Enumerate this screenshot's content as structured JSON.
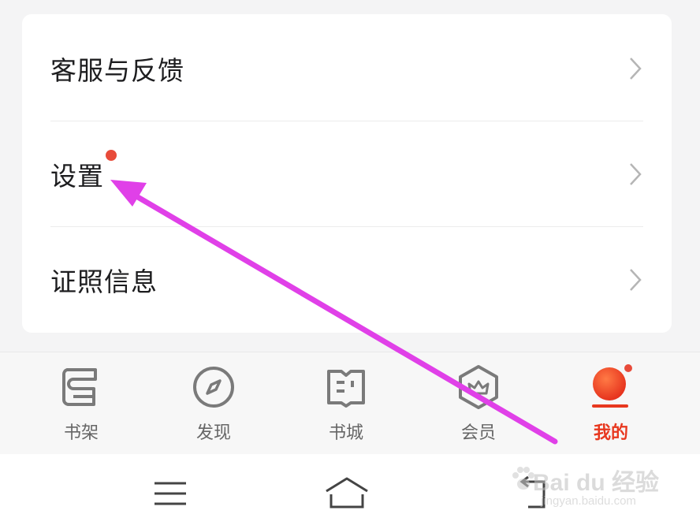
{
  "menu": {
    "items": [
      {
        "label": "客服与反馈"
      },
      {
        "label": "设置"
      },
      {
        "label": "证照信息"
      }
    ]
  },
  "tabs": [
    {
      "label": "书架",
      "icon": "bookshelf-icon"
    },
    {
      "label": "发现",
      "icon": "compass-icon"
    },
    {
      "label": "书城",
      "icon": "book-store-icon"
    },
    {
      "label": "会员",
      "icon": "vip-crown-icon"
    },
    {
      "label": "我的",
      "icon": "profile-avatar-icon",
      "active": true
    }
  ],
  "watermark": {
    "main": "Bai du 经验",
    "sub": "jingyan.baidu.com"
  },
  "colors": {
    "accent": "#e8381f",
    "badge": "#e84b3a",
    "annotation_arrow": "#e040e8"
  }
}
